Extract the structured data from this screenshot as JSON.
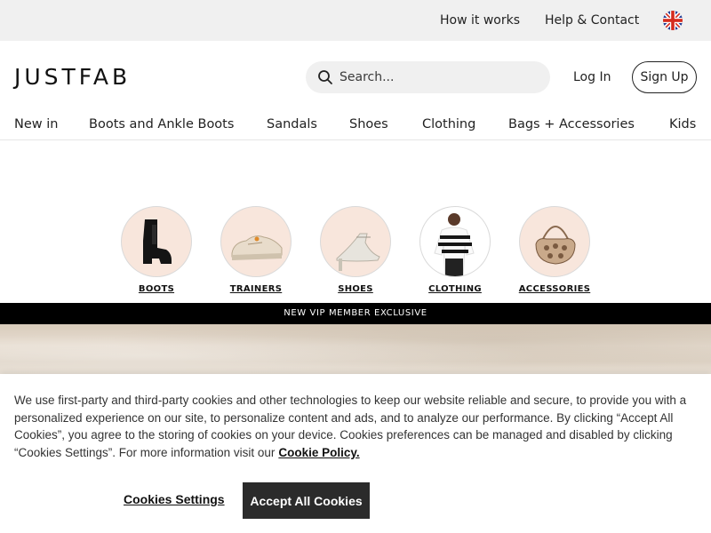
{
  "utility_bar": {
    "how_it_works": "How it works",
    "help_contact": "Help & Contact"
  },
  "header": {
    "logo": "JUSTFAB",
    "search_placeholder": "Search...",
    "login": "Log In",
    "signup": "Sign Up"
  },
  "nav": {
    "items": [
      {
        "label": "New in"
      },
      {
        "label": "Boots and Ankle Boots"
      },
      {
        "label": "Sandals"
      },
      {
        "label": "Shoes"
      },
      {
        "label": "Clothing"
      },
      {
        "label": "Bags + Accessories"
      },
      {
        "label": "Kids"
      }
    ]
  },
  "categories": [
    {
      "label": "BOOTS"
    },
    {
      "label": "TRAINERS"
    },
    {
      "label": "SHOES"
    },
    {
      "label": "CLOTHING"
    },
    {
      "label": "ACCESSORIES"
    }
  ],
  "promo": {
    "strip_text": "NEW VIP MEMBER EXCLUSIVE"
  },
  "cookie_banner": {
    "text": "We use first-party and third-party cookies and other technologies to keep our website reliable and secure, to provide you with a personalized experience on our site, to personalize content and ads, and to analyze our performance. By clicking “Accept All Cookies”, you agree to the storing of cookies on your device. Cookies preferences can be managed and disabled by clicking “Cookies Settings”. For more information visit our",
    "policy_link": "Cookie Policy.",
    "settings_button": "Cookies Settings",
    "accept_button": "Accept All Cookies"
  },
  "colors": {
    "category_bg": "#f8e6dc",
    "utility_bg": "#f0f0f0",
    "accept_bg": "#2b2b2b"
  }
}
